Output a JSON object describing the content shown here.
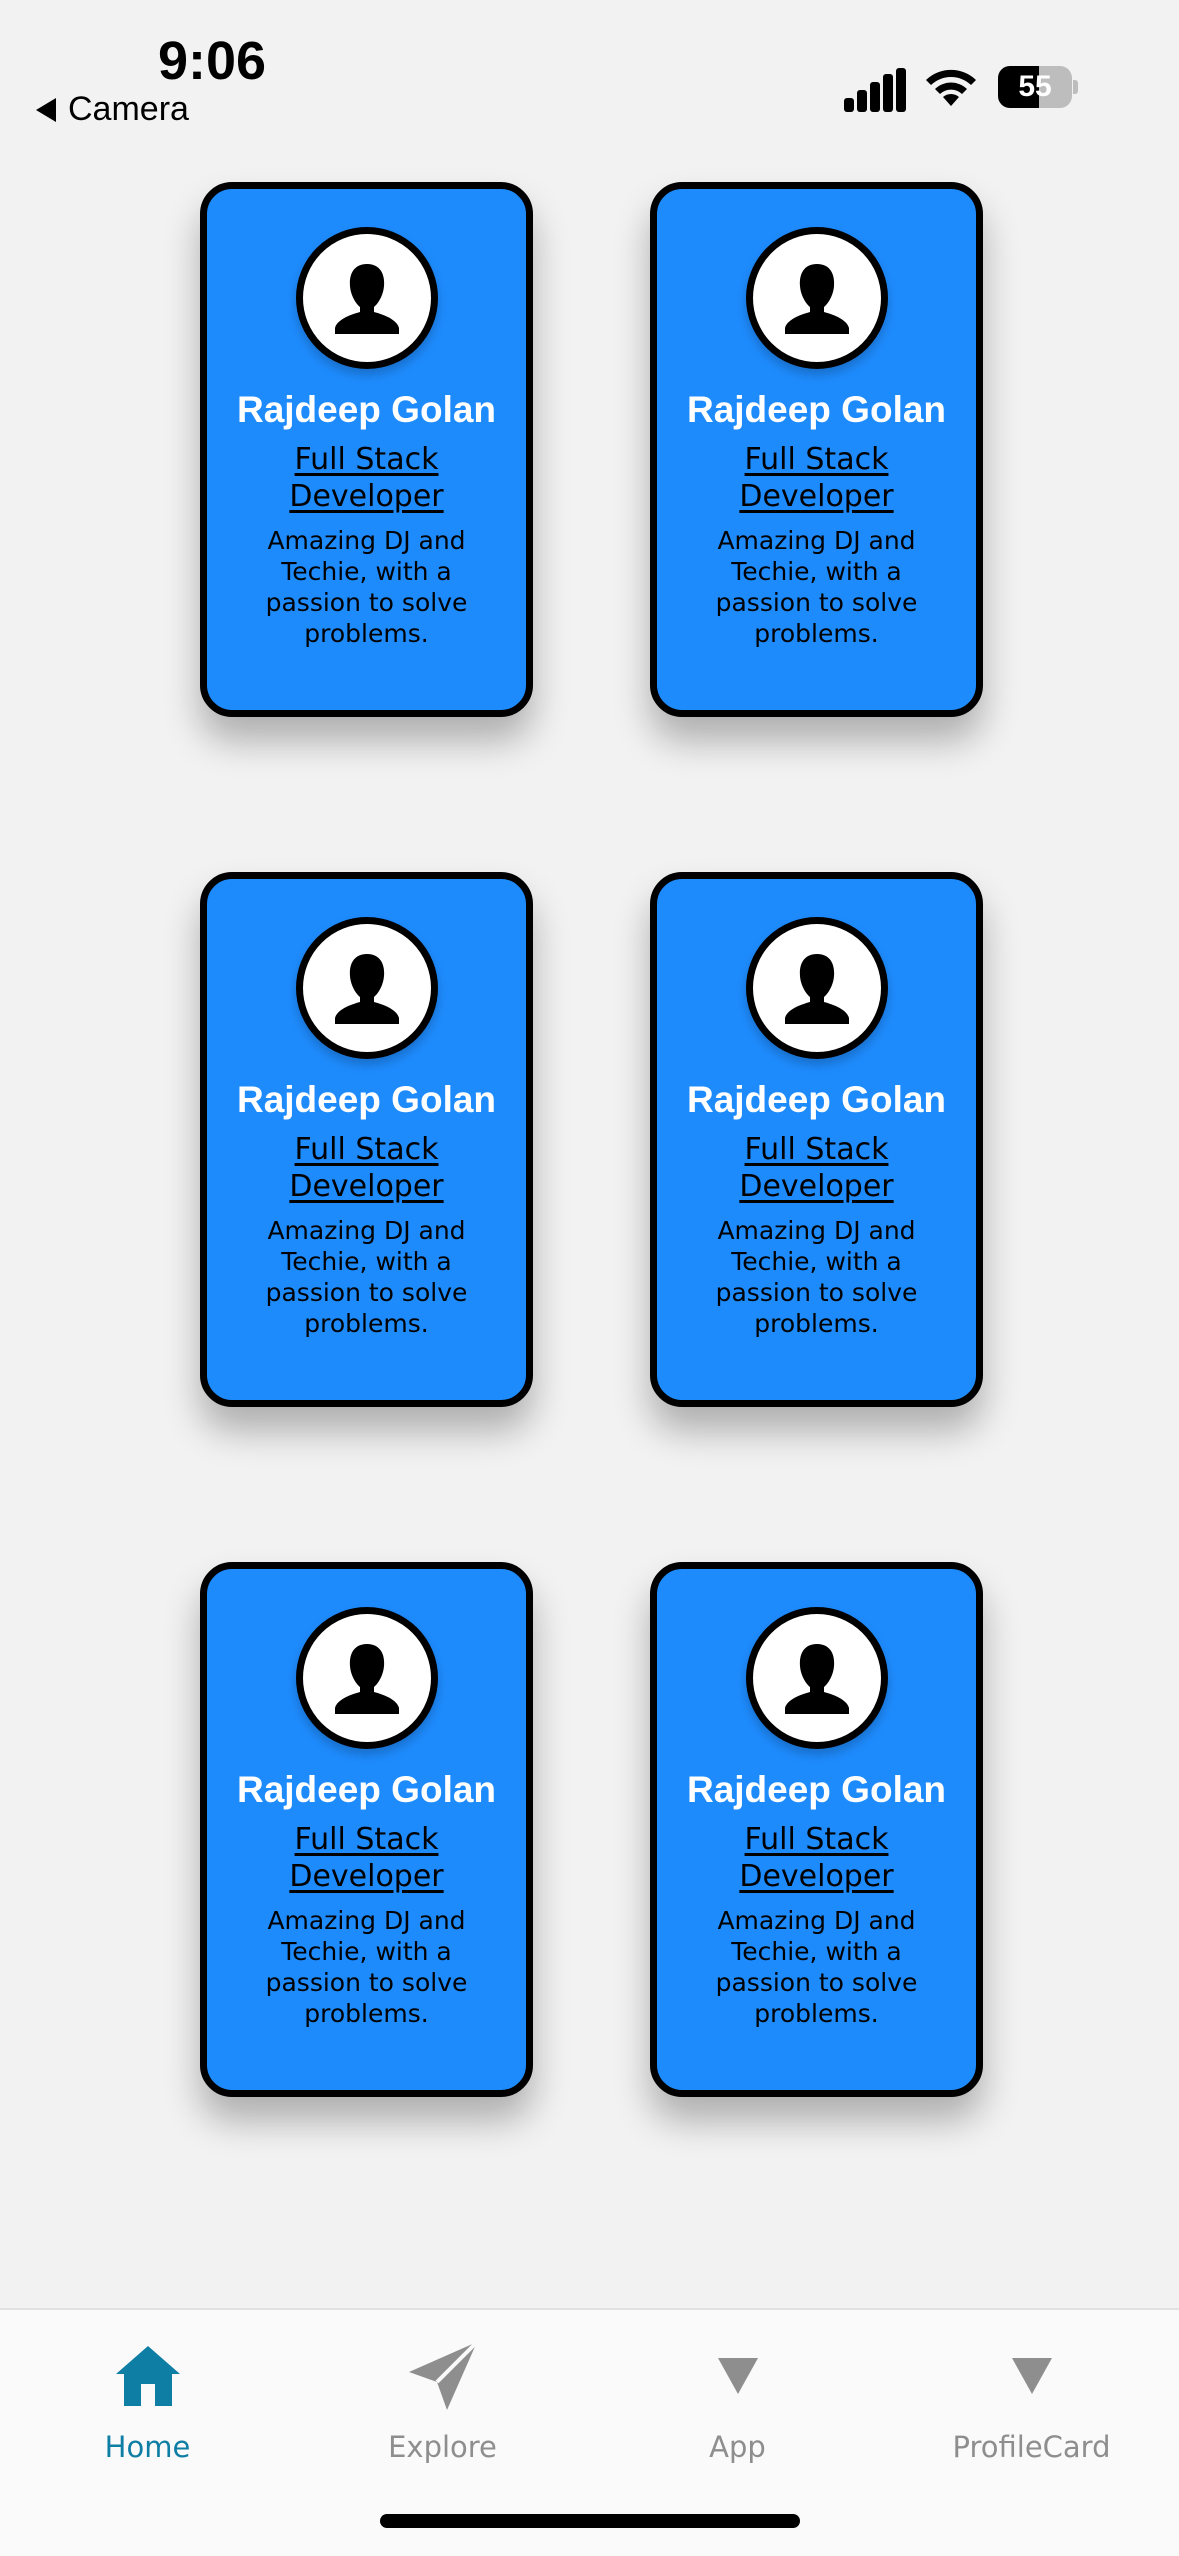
{
  "status_bar": {
    "time": "9:06",
    "back_label": "Camera",
    "battery_level": "55"
  },
  "cards": [
    {
      "name": "Rajdeep Golan",
      "role": "Full Stack Developer",
      "bio": "Amazing DJ and Techie, with a passion to solve problems."
    },
    {
      "name": "Rajdeep Golan",
      "role": "Full Stack Developer",
      "bio": "Amazing DJ and Techie, with a passion to solve problems."
    },
    {
      "name": "Rajdeep Golan",
      "role": "Full Stack Developer",
      "bio": "Amazing DJ and Techie, with a passion to solve problems."
    },
    {
      "name": "Rajdeep Golan",
      "role": "Full Stack Developer",
      "bio": "Amazing DJ and Techie, with a passion to solve problems."
    },
    {
      "name": "Rajdeep Golan",
      "role": "Full Stack Developer",
      "bio": "Amazing DJ and Techie, with a passion to solve problems."
    },
    {
      "name": "Rajdeep Golan",
      "role": "Full Stack Developer",
      "bio": "Amazing DJ and Techie, with a passion to solve problems."
    }
  ],
  "tab_bar": {
    "tabs": [
      {
        "label": "Home",
        "icon": "home-icon",
        "active": true
      },
      {
        "label": "Explore",
        "icon": "paper-plane-icon",
        "active": false
      },
      {
        "label": "App",
        "icon": "triangle-down-icon",
        "active": false
      },
      {
        "label": "ProfileCard",
        "icon": "triangle-down-icon",
        "active": false
      }
    ]
  },
  "colors": {
    "background": "#f2f2f2",
    "card": "#1e8bfd",
    "card_border": "#000000",
    "tab_active": "#0f7ea4",
    "tab_inactive": "#8e8e8e"
  }
}
